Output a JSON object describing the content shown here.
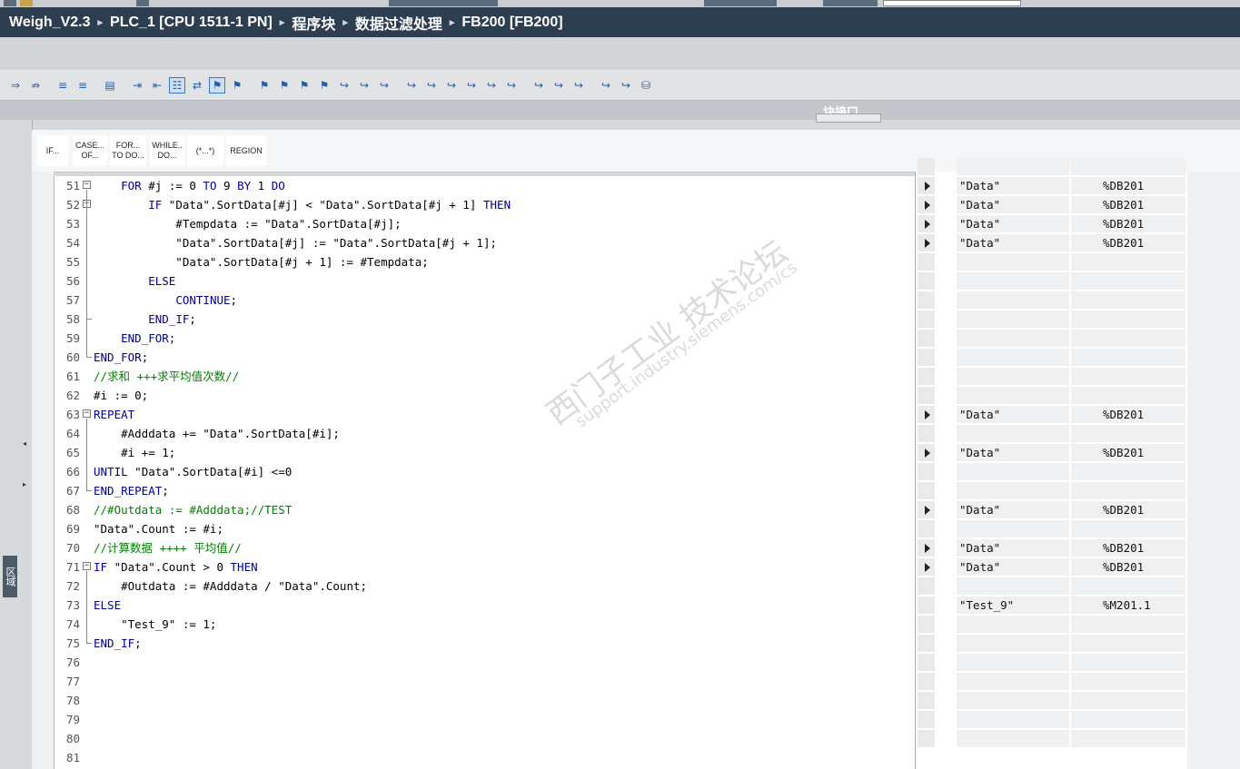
{
  "breadcrumb": {
    "items": [
      "Weigh_V2.3",
      "PLC_1 [CPU 1511-1 PN]",
      "程序块",
      "数据过滤处理",
      "FB200 [FB200]"
    ],
    "separator": "▸"
  },
  "toolbar": {
    "icons": [
      "insert-network-icon",
      "delete-network-icon",
      "insert-row-icon",
      "insert-row-icon",
      "monitor-icon",
      "indent-icon",
      "outdent-icon",
      "list-icon",
      "compare-icon",
      "bookmark-icon",
      "bookmark-icon",
      "bookmark-icon",
      "bookmark-icon",
      "bookmark-icon",
      "bookmark-icon",
      "go-to-icon",
      "go-to-icon",
      "go-to-icon",
      "go-to-icon",
      "go-to-icon",
      "go-to-icon",
      "go-to-icon",
      "go-to-icon",
      "go-to-icon",
      "go-to-icon",
      "go-to-icon",
      "go-to-icon",
      "go-to-icon",
      "go-to-icon",
      "database-icon"
    ]
  },
  "interface_bar": {
    "label": "块接口"
  },
  "left_strip": {
    "tab_label": "区域"
  },
  "snippets": [
    {
      "label": "IF..."
    },
    {
      "label": "CASE... OF..."
    },
    {
      "label": "FOR... TO DO..."
    },
    {
      "label": "WHILE.. DO..."
    },
    {
      "label": "(*...*)"
    },
    {
      "label": "REGION"
    }
  ],
  "code_lines": [
    {
      "n": "51",
      "text": "    FOR #j := 0 TO 9 BY 1 DO"
    },
    {
      "n": "52",
      "text": "        IF \"Data\".SortData[#j] < \"Data\".SortData[#j + 1] THEN"
    },
    {
      "n": "53",
      "text": "            #Tempdata := \"Data\".SortData[#j];"
    },
    {
      "n": "54",
      "text": "            \"Data\".SortData[#j] := \"Data\".SortData[#j + 1];"
    },
    {
      "n": "55",
      "text": "            \"Data\".SortData[#j + 1] := #Tempdata;"
    },
    {
      "n": "56",
      "text": "        ELSE"
    },
    {
      "n": "57",
      "text": "            CONTINUE;"
    },
    {
      "n": "58",
      "text": "        END_IF;"
    },
    {
      "n": "59",
      "text": "    END_FOR;"
    },
    {
      "n": "60",
      "text": "END_FOR;"
    },
    {
      "n": "61",
      "text": "//求和 +++求平均值次数//"
    },
    {
      "n": "62",
      "text": "#i := 0;"
    },
    {
      "n": "63",
      "text": "REPEAT"
    },
    {
      "n": "64",
      "text": "    #Adddata += \"Data\".SortData[#i];"
    },
    {
      "n": "65",
      "text": "    #i += 1;"
    },
    {
      "n": "66",
      "text": "UNTIL \"Data\".SortData[#i] <=0"
    },
    {
      "n": "67",
      "text": "END_REPEAT;"
    },
    {
      "n": "68",
      "text": "//#Outdata := #Adddata;//TEST"
    },
    {
      "n": "69",
      "text": "\"Data\".Count := #i;"
    },
    {
      "n": "70",
      "text": "//计算数据 ++++ 平均值//"
    },
    {
      "n": "71",
      "text": "IF \"Data\".Count > 0 THEN"
    },
    {
      "n": "72",
      "text": "    #Outdata := #Adddata / \"Data\".Count;"
    },
    {
      "n": "73",
      "text": "ELSE"
    },
    {
      "n": "74",
      "text": "    \"Test_9\" := 1;"
    },
    {
      "n": "75",
      "text": "END_IF;"
    },
    {
      "n": "76",
      "text": ""
    },
    {
      "n": "77",
      "text": ""
    },
    {
      "n": "78",
      "text": ""
    },
    {
      "n": "79",
      "text": ""
    },
    {
      "n": "80",
      "text": ""
    },
    {
      "n": "81",
      "text": ""
    }
  ],
  "operands": [
    {
      "arrow": false,
      "name": "",
      "address": ""
    },
    {
      "arrow": true,
      "name": "\"Data\"",
      "address": "%DB201"
    },
    {
      "arrow": true,
      "name": "\"Data\"",
      "address": "%DB201"
    },
    {
      "arrow": true,
      "name": "\"Data\"",
      "address": "%DB201"
    },
    {
      "arrow": true,
      "name": "\"Data\"",
      "address": "%DB201"
    },
    {
      "arrow": false,
      "name": "",
      "address": ""
    },
    {
      "arrow": false,
      "name": "",
      "address": ""
    },
    {
      "arrow": false,
      "name": "",
      "address": ""
    },
    {
      "arrow": false,
      "name": "",
      "address": ""
    },
    {
      "arrow": false,
      "name": "",
      "address": ""
    },
    {
      "arrow": false,
      "name": "",
      "address": ""
    },
    {
      "arrow": false,
      "name": "",
      "address": ""
    },
    {
      "arrow": false,
      "name": "",
      "address": ""
    },
    {
      "arrow": true,
      "name": "\"Data\"",
      "address": "%DB201"
    },
    {
      "arrow": false,
      "name": "",
      "address": ""
    },
    {
      "arrow": true,
      "name": "\"Data\"",
      "address": "%DB201"
    },
    {
      "arrow": false,
      "name": "",
      "address": ""
    },
    {
      "arrow": false,
      "name": "",
      "address": ""
    },
    {
      "arrow": true,
      "name": "\"Data\"",
      "address": "%DB201"
    },
    {
      "arrow": false,
      "name": "",
      "address": ""
    },
    {
      "arrow": true,
      "name": "\"Data\"",
      "address": "%DB201"
    },
    {
      "arrow": true,
      "name": "\"Data\"",
      "address": "%DB201"
    },
    {
      "arrow": false,
      "name": "",
      "address": ""
    },
    {
      "arrow": false,
      "name": "\"Test_9\"",
      "address": "%M201.1"
    },
    {
      "arrow": false,
      "name": "",
      "address": ""
    },
    {
      "arrow": false,
      "name": "",
      "address": ""
    },
    {
      "arrow": false,
      "name": "",
      "address": ""
    },
    {
      "arrow": false,
      "name": "",
      "address": ""
    },
    {
      "arrow": false,
      "name": "",
      "address": ""
    },
    {
      "arrow": false,
      "name": "",
      "address": ""
    },
    {
      "arrow": false,
      "name": "",
      "address": ""
    }
  ],
  "watermark": {
    "line1": "西门子工业 技术论坛",
    "line2": "support.industry.siemens.com/cs"
  },
  "colors": {
    "keyword": "#00008b",
    "comment": "#008000",
    "titlebar": "#2c3e50"
  }
}
